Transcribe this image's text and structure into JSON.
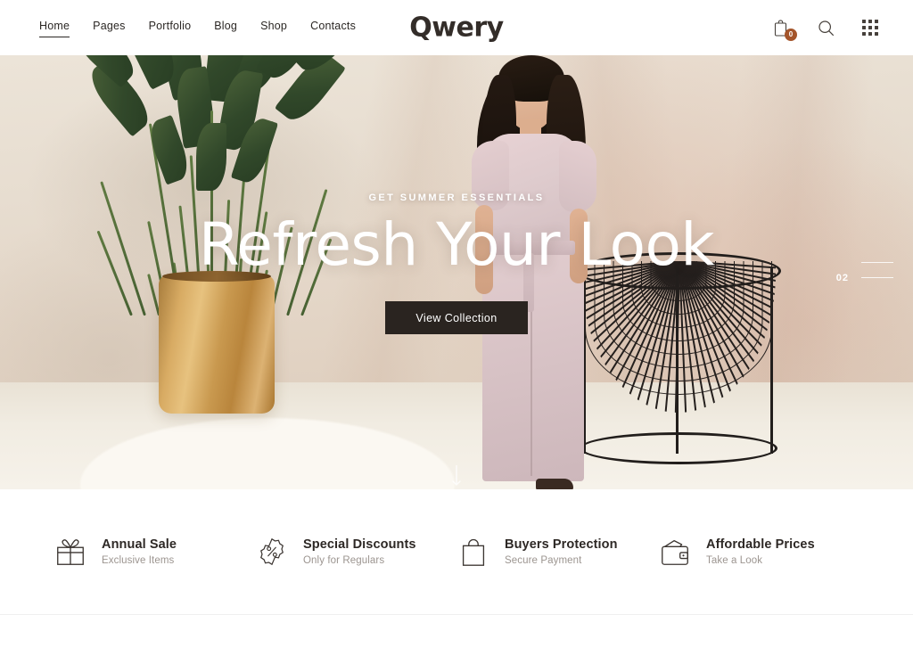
{
  "site": {
    "logo": "Qwery"
  },
  "header": {
    "nav": [
      {
        "label": "Home",
        "active": true
      },
      {
        "label": "Pages",
        "active": false
      },
      {
        "label": "Portfolio",
        "active": false
      },
      {
        "label": "Blog",
        "active": false
      },
      {
        "label": "Shop",
        "active": false
      },
      {
        "label": "Contacts",
        "active": false
      }
    ],
    "actions": {
      "cart_icon": "shopping-bag-icon",
      "cart_count": "0",
      "search_icon": "search-icon",
      "grid_icon": "grid-menu-icon"
    },
    "badge_color": "#a4552b"
  },
  "hero": {
    "subtitle": "GET SUMMER ESSENTIALS",
    "title": "Refresh Your Look",
    "button_label": "View Collection",
    "slide_number": "02",
    "scroll_icon": "scroll-down-arrow-icon",
    "button_color": "#2a2420",
    "text_color": "#ffffff"
  },
  "features": [
    {
      "icon": "gift-icon",
      "title": "Annual Sale",
      "subtitle": "Exclusive Items"
    },
    {
      "icon": "percent-badge-icon",
      "title": "Special Discounts",
      "subtitle": "Only for Regulars"
    },
    {
      "icon": "shopping-bag-icon",
      "title": "Buyers Protection",
      "subtitle": "Secure Payment"
    },
    {
      "icon": "wallet-icon",
      "title": "Affordable Prices",
      "subtitle": "Take a Look"
    }
  ]
}
